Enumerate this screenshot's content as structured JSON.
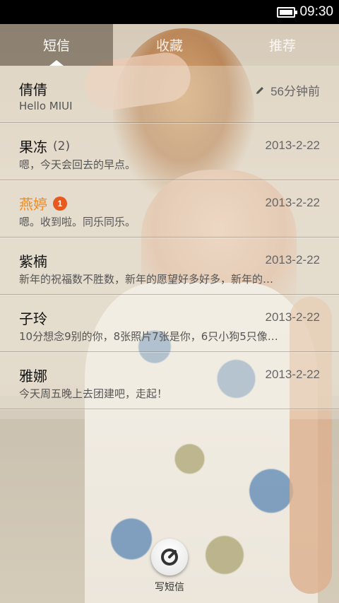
{
  "status_bar": {
    "time": "09:30"
  },
  "tabs": [
    {
      "label": "短信",
      "active": true
    },
    {
      "label": "收藏",
      "active": false
    },
    {
      "label": "推荐",
      "active": false
    }
  ],
  "conversations": [
    {
      "name": "倩倩",
      "count": "",
      "badge": "",
      "time": "56分钟前",
      "preview": "Hello MIUI",
      "unread": false,
      "draft": true
    },
    {
      "name": "果冻",
      "count": "(2)",
      "badge": "",
      "time": "2013-2-22",
      "preview": "嗯，今天会回去的早点。",
      "unread": false
    },
    {
      "name": "燕婷",
      "count": "",
      "badge": "1",
      "time": "2013-2-22",
      "preview": "嗯。收到啦。同乐同乐。",
      "unread": true
    },
    {
      "name": "紫楠",
      "count": "",
      "badge": "",
      "time": "2013-2-22",
      "preview": "新年的祝福数不胜数，新年的愿望好多好多，新年的…",
      "unread": false
    },
    {
      "name": "子玲",
      "count": "",
      "badge": "",
      "time": "2013-2-22",
      "preview": "10分想念9别的你，8张照片7张是你，6只小狗5只像…",
      "unread": false
    },
    {
      "name": "雅娜",
      "count": "",
      "badge": "",
      "time": "2013-2-22",
      "preview": "今天周五晚上去团建吧，走起！",
      "unread": false
    }
  ],
  "compose": {
    "label": "写短信"
  },
  "colors": {
    "unread_name": "#f08b22",
    "badge_bg": "#e65a1e"
  },
  "icons": {
    "battery": "battery-icon",
    "draft": "pencil-icon",
    "compose": "compose-icon"
  }
}
